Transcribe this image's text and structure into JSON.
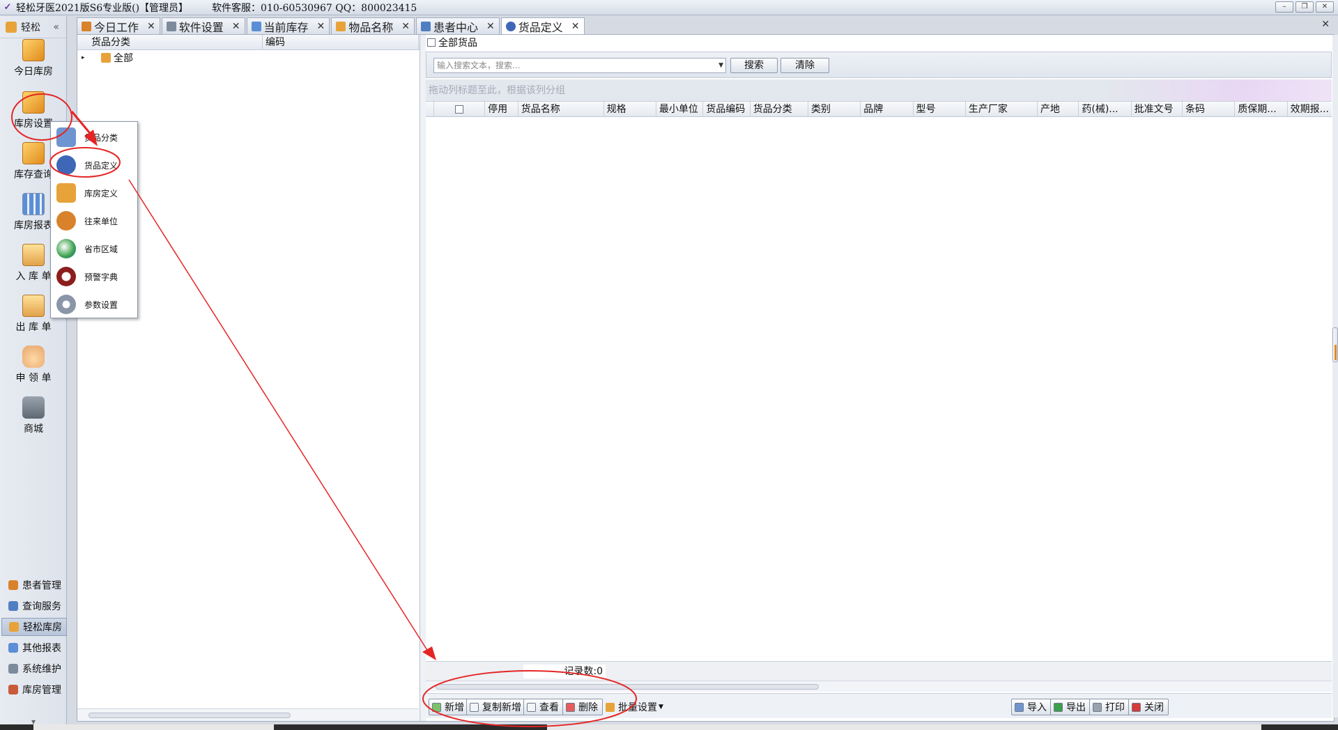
{
  "window": {
    "title": "轻松牙医2021版S6专业版()【管理员】",
    "service": "软件客服：010-60530967 QQ：800023415",
    "controls": [
      "–",
      "❐",
      "✕"
    ]
  },
  "sidebar": {
    "header": "轻松",
    "collapse": "«",
    "big_items": [
      {
        "label": "今日库房",
        "icon": "box-icon"
      },
      {
        "label": "库房设置",
        "icon": "warehouse-gear-icon"
      },
      {
        "label": "库存查询",
        "icon": "boxes-icon"
      },
      {
        "label": "库房报表",
        "icon": "report-icon"
      },
      {
        "label": "入 库 单",
        "icon": "inbox-icon"
      },
      {
        "label": "出 库 单",
        "icon": "outbox-icon"
      },
      {
        "label": "申 领 单",
        "icon": "hand-icon"
      },
      {
        "label": "商城",
        "icon": "cart-icon"
      }
    ],
    "small_items": [
      {
        "label": "患者管理",
        "color": "#d9822b"
      },
      {
        "label": "查询服务",
        "color": "#4f7fc2"
      },
      {
        "label": "轻松库房",
        "color": "#e7a33a"
      },
      {
        "label": "其他报表",
        "color": "#5b8ed6"
      },
      {
        "label": "系统维护",
        "color": "#7c8a9c"
      },
      {
        "label": "库房管理",
        "color": "#c85a3a"
      }
    ],
    "footer": "▾"
  },
  "popup_menu": {
    "items": [
      {
        "label": "货品分类",
        "color": "#6f95d0"
      },
      {
        "label": "货品定义",
        "color": "#3f67b8"
      },
      {
        "label": "库房定义",
        "color": "#e7a33a"
      },
      {
        "label": "往来单位",
        "color": "#d9822b"
      },
      {
        "label": "省市区域",
        "color": "#3aa04a"
      },
      {
        "label": "预警字典",
        "color": "#8c1d1d"
      },
      {
        "label": "参数设置",
        "color": "#8a96a8"
      }
    ]
  },
  "tabs": [
    {
      "label": "今日工作",
      "color": "#d9822b"
    },
    {
      "label": "软件设置",
      "color": "#7c8a9c"
    },
    {
      "label": "当前库存",
      "color": "#5b8ed6"
    },
    {
      "label": "物品名称",
      "color": "#e7a33a"
    },
    {
      "label": "患者中心",
      "color": "#4f7fc2"
    },
    {
      "label": "货品定义",
      "color": "#3f67b8"
    }
  ],
  "tab_close": "✕",
  "tree": {
    "headers": [
      "货品分类",
      "编码"
    ],
    "root": "全部"
  },
  "filter": {
    "all_goods": "全部货品",
    "search_placeholder": "输入搜索文本，搜索...",
    "search_button": "搜索",
    "clear_button": "清除",
    "group_hint": "拖动列标题至此，根据该列分组"
  },
  "grid": {
    "columns": [
      "停用",
      "货品名称",
      "规格",
      "最小单位",
      "货品编码",
      "货品分类",
      "类别",
      "品牌",
      "型号",
      "生产厂家",
      "产地",
      "药(械)...",
      "批准文号",
      "条码",
      "质保期...",
      "效期报..."
    ],
    "record_count": "记录数:0"
  },
  "toolbar": {
    "new": "新增",
    "copy_new": "复制新增",
    "view": "查看",
    "delete": "删除",
    "batch": "批量设置",
    "import": "导入",
    "export": "导出",
    "print": "打印",
    "close": "关闭"
  }
}
